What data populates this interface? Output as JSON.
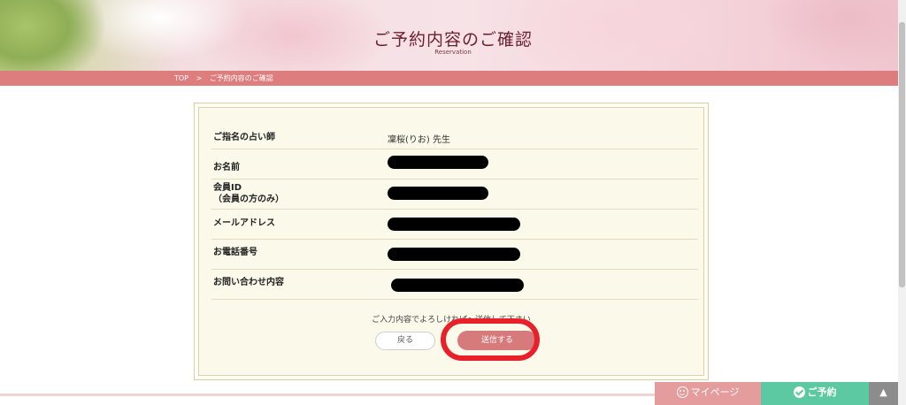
{
  "header": {
    "title": "ご予約内容のご確認",
    "subtitle": "Reservation"
  },
  "breadcrumb": {
    "home": "TOP",
    "separator": ">",
    "current": "ご予約内容のご確認"
  },
  "form": {
    "rows": [
      {
        "label": "ご指名の占い師",
        "value": "凜桜(りお) 先生"
      },
      {
        "label": "お名前",
        "value": ""
      },
      {
        "label": "会員ID\n（会員の方のみ）",
        "value": ""
      },
      {
        "label": "メールアドレス",
        "value": ""
      },
      {
        "label": "お電話番号",
        "value": ""
      },
      {
        "label": "お問い合わせ内容",
        "value": ""
      }
    ],
    "confirm_message": "ご入力内容でよろしければ〜送信して下さい",
    "back_label": "戻る",
    "send_label": "送信する"
  },
  "footer_nav": {
    "mypage_label": "マイページ",
    "reserve_label": "ご予約",
    "top_label": "▲"
  },
  "colors": {
    "accent_pink": "#de7d7e",
    "send_button": "#d67a7c",
    "reserve_green": "#5cc9a3",
    "highlight_red": "#e8202a"
  },
  "icons": {
    "mypage": "smile-icon",
    "reserve": "check-circle-icon",
    "top": "triangle-up-icon"
  }
}
